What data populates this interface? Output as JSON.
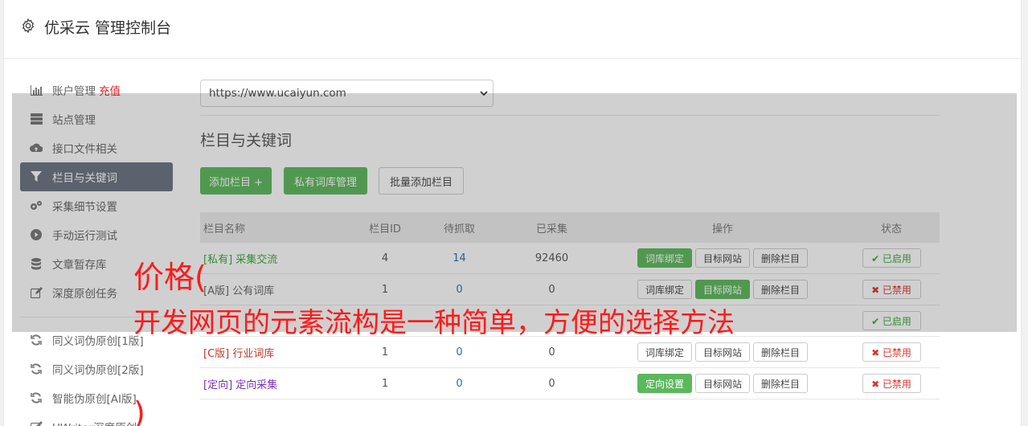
{
  "header": {
    "title": "优采云 管理控制台",
    "icon": "gear-icon"
  },
  "sidebar": {
    "items": [
      {
        "label": "账户管理",
        "extra": "充值",
        "icon": "bar-chart-icon"
      },
      {
        "label": "站点管理",
        "icon": "server-icon"
      },
      {
        "label": "接口文件相关",
        "icon": "cloud-upload-icon"
      },
      {
        "label": "栏目与关键词",
        "icon": "filter-icon",
        "active": true
      },
      {
        "label": "采集细节设置",
        "icon": "cogs-icon"
      },
      {
        "label": "手动运行测试",
        "icon": "play-circle-icon"
      },
      {
        "label": "文章暂存库",
        "icon": "database-icon"
      },
      {
        "label": "深度原创任务",
        "icon": "edit-icon"
      }
    ],
    "items2": [
      {
        "label": "同义词伪原创[1版]",
        "icon": "refresh-icon"
      },
      {
        "label": "同义词伪原创[2版]",
        "icon": "refresh-icon"
      },
      {
        "label": "智能伪原创[AI版]",
        "icon": "refresh-icon"
      },
      {
        "label": "UWriter深度原创",
        "icon": "edit-icon"
      }
    ]
  },
  "site_select": {
    "value": "https://www.ucaiyun.com"
  },
  "main": {
    "section_title": "栏目与关键词",
    "buttons": {
      "add_column": "添加栏目 +",
      "private_lib": "私有词库管理",
      "batch_add": "批量添加栏目"
    }
  },
  "table": {
    "headers": [
      "栏目名称",
      "栏目ID",
      "待抓取",
      "已采集",
      "操作",
      "状态"
    ],
    "rows": [
      {
        "tag": "[私有]",
        "name": "采集交流",
        "id": "4",
        "pending": "14",
        "collected": "92460",
        "op1": "词库绑定",
        "op2": "目标网站",
        "op3": "删除栏目",
        "status": "✔ 已启用"
      },
      {
        "tag": "[A版]",
        "name": "公有词库",
        "id": "1",
        "pending": "0",
        "collected": "0",
        "op1": "词库绑定",
        "op2": "目标网站",
        "op3": "删除栏目",
        "status": "✖ 已禁用"
      },
      {
        "tag": "[C版]",
        "name": "行业词库",
        "id": "1",
        "pending": "0",
        "collected": "0",
        "op1": "词库绑定",
        "op2": "目标网站",
        "op3": "删除栏目",
        "status": "✖ 已禁用"
      },
      {
        "tag": "[定向]",
        "name": "定向采集",
        "id": "1",
        "pending": "0",
        "collected": "0",
        "op1": "定向设置",
        "op2": "目标网站",
        "op3": "删除栏目",
        "status": "✖ 已禁用"
      }
    ],
    "hidden_row": {
      "status": "✔ 已启用"
    }
  },
  "overlay": {
    "line1": "价格(",
    "line2": "开发网页的元素流构是一种简单，方便的选择方法",
    "paren": ")"
  },
  "colors": {
    "green": "#5cb85c",
    "active_nav": "#6b7280",
    "overlay_text": "#ff1a1a"
  }
}
